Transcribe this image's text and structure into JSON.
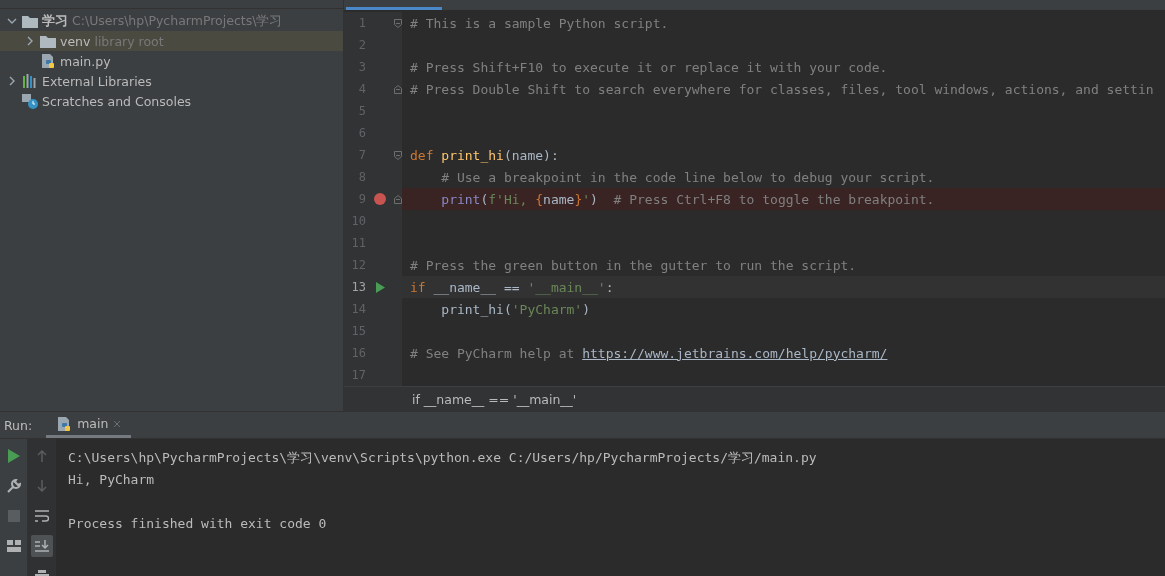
{
  "project_tree": [
    {
      "label": "学习",
      "hint": "C:\\Users\\hp\\PycharmProjects\\学习",
      "kind": "folder",
      "expanded": true,
      "selected": false,
      "children": [
        {
          "label": "venv",
          "hint": "library root",
          "kind": "folder",
          "expanded": false,
          "selected": true
        },
        {
          "label": "main.py",
          "kind": "python",
          "selected": false
        }
      ]
    },
    {
      "label": "External Libraries",
      "kind": "libraries",
      "expanded": false,
      "selected": false
    },
    {
      "label": "Scratches and Consoles",
      "kind": "scratches",
      "selected": false
    }
  ],
  "editor": {
    "lines": [
      {
        "number": "1",
        "fold_start": true,
        "tokens": [
          {
            "kind": "comment",
            "text": "# This is a sample Python script."
          }
        ]
      },
      {
        "number": "2"
      },
      {
        "number": "3",
        "tokens": [
          {
            "kind": "comment",
            "text": "# Press Shift+F10 to execute it or replace it with your code."
          }
        ]
      },
      {
        "number": "4",
        "fold_end": true,
        "tokens": [
          {
            "kind": "comment",
            "text": "# Press Double Shift to search everywhere for classes, files, tool windows, actions, and settin"
          }
        ]
      },
      {
        "number": "5"
      },
      {
        "number": "6"
      },
      {
        "number": "7",
        "fold_start": true,
        "tokens": [
          {
            "kind": "keyword",
            "text": "def "
          },
          {
            "kind": "function",
            "text": "print_hi"
          },
          {
            "kind": "plain",
            "text": "(name):"
          }
        ]
      },
      {
        "number": "8",
        "tokens": [
          {
            "kind": "comment",
            "text": "    # Use a breakpoint in the code line below to debug your script."
          }
        ]
      },
      {
        "number": "9",
        "fold_end": true,
        "breakpoint": true,
        "tokens": [
          {
            "kind": "builtin",
            "text": "    print"
          },
          {
            "kind": "plain",
            "text": "("
          },
          {
            "kind": "string",
            "text": "f'Hi, "
          },
          {
            "kind": "brace",
            "text": "{"
          },
          {
            "kind": "plain",
            "text": "name"
          },
          {
            "kind": "brace",
            "text": "}"
          },
          {
            "kind": "string",
            "text": "'"
          },
          {
            "kind": "plain",
            "text": ")  "
          },
          {
            "kind": "comment",
            "text": "# Press Ctrl+F8 to toggle the breakpoint."
          }
        ]
      },
      {
        "number": "10"
      },
      {
        "number": "11"
      },
      {
        "number": "12",
        "tokens": [
          {
            "kind": "comment",
            "text": "# Press the green button in the gutter to run the script."
          }
        ]
      },
      {
        "number": "13",
        "run": true,
        "current": true,
        "tokens": [
          {
            "kind": "keyword",
            "text": "if "
          },
          {
            "kind": "plain",
            "text": "__name__ == "
          },
          {
            "kind": "string",
            "text": "'__main__'"
          },
          {
            "kind": "plain",
            "text": ":"
          }
        ]
      },
      {
        "number": "14",
        "tokens": [
          {
            "kind": "plain",
            "text": "    print_hi("
          },
          {
            "kind": "string",
            "text": "'PyCharm'"
          },
          {
            "kind": "plain",
            "text": ")"
          }
        ]
      },
      {
        "number": "15"
      },
      {
        "number": "16",
        "tokens": [
          {
            "kind": "comment",
            "text": "# See PyCharm help at "
          },
          {
            "kind": "link",
            "text": "https://www.jetbrains.com/help/pycharm/"
          }
        ]
      },
      {
        "number": "17"
      }
    ],
    "breadcrumb": "if __name__ == '__main__'"
  },
  "run_panel": {
    "label": "Run:",
    "tabs": [
      {
        "label": "main",
        "selected": true
      }
    ],
    "output": [
      {
        "kind": "command",
        "text": "C:\\Users\\hp\\PycharmProjects\\学习\\venv\\Scripts\\python.exe C:/Users/hp/PycharmProjects/学习/main.py"
      },
      {
        "kind": "stdout",
        "text": "Hi, PyCharm"
      },
      {
        "kind": "status",
        "text": "Process finished with exit code 0"
      }
    ]
  }
}
